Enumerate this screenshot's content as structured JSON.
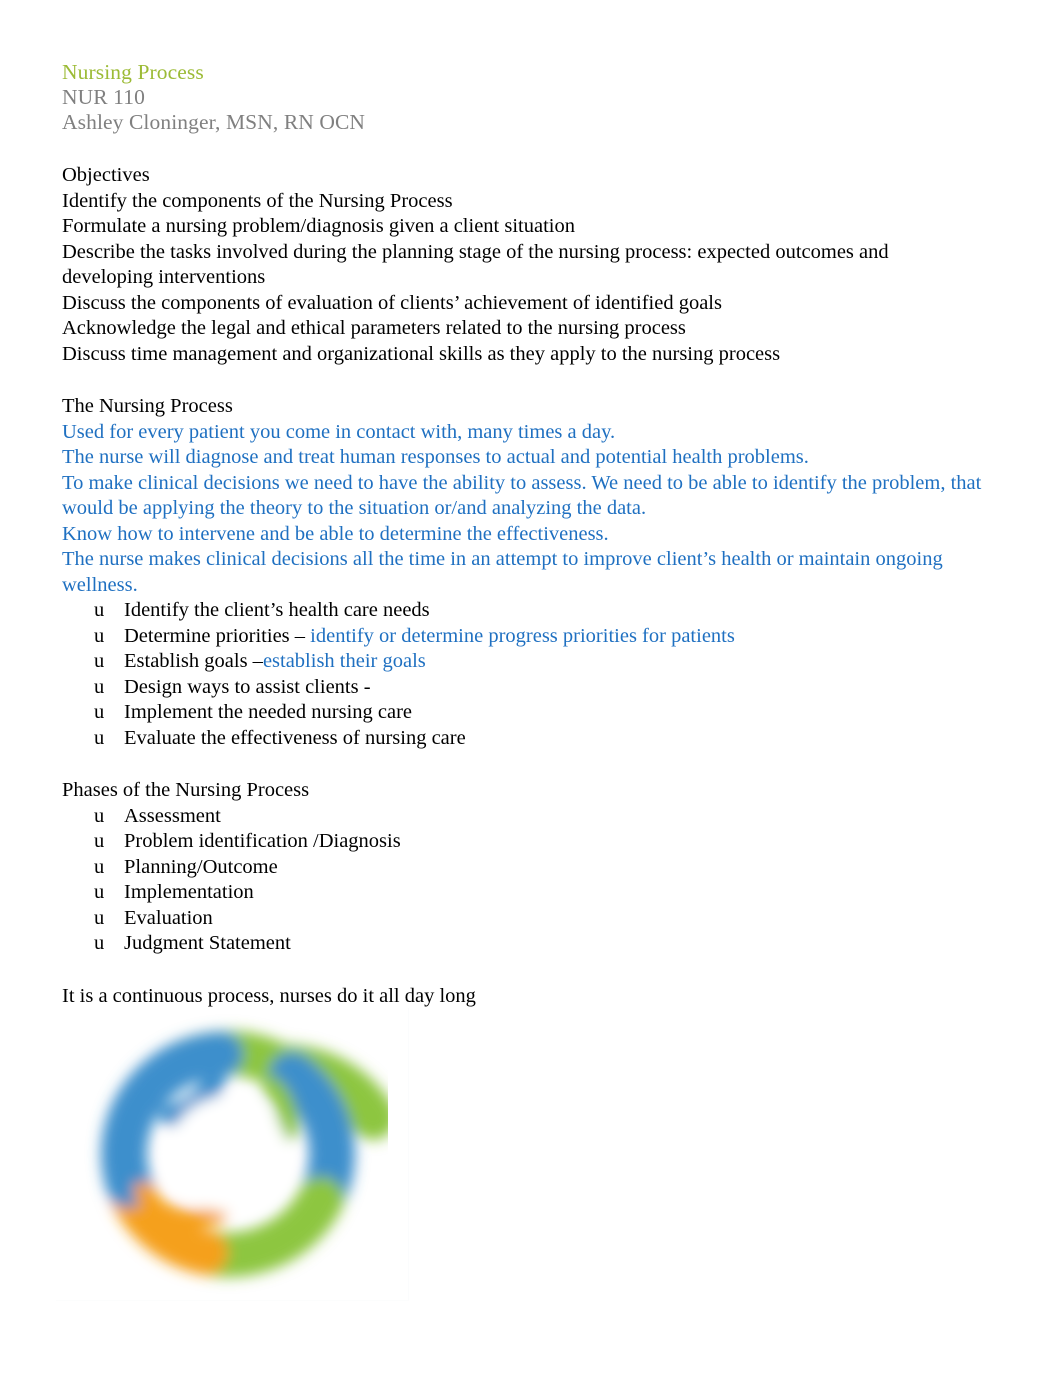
{
  "header": {
    "title": "Nursing Process",
    "course": "NUR 110",
    "author": "Ashley Cloninger, MSN, RN OCN",
    "title_color": "#9CBB36",
    "subtitle_color": "#808080"
  },
  "objectives": {
    "heading": "Objectives",
    "items": [
      "Identify the components of the Nursing Process",
      "Formulate a nursing problem/diagnosis given a client situation",
      "Describe the tasks involved during the planning stage of the nursing process: expected outcomes and developing interventions",
      "Discuss the components of evaluation of clients’ achievement of identified goals",
      "Acknowledge the legal and ethical parameters related to the nursing process",
      "Discuss time management and organizational skills as they apply to the nursing process"
    ]
  },
  "nursing_process": {
    "heading": "The Nursing Process",
    "blue_color": "#1F70C1",
    "paragraphs": [
      "Used for every patient you come in contact with, many times a day.",
      "The nurse will diagnose and treat human responses to actual and potential health problems.",
      "To make clinical decisions we need to have the ability to assess. We need to be able to identify the problem, that would be applying the theory to the situation or/and analyzing the data.",
      "Know how to intervene and be able to determine the effectiveness.",
      "The nurse makes clinical decisions all the time in an attempt to improve client’s health or maintain ongoing wellness."
    ],
    "bullet_glyph": "u",
    "bullets": [
      {
        "black": "Identify the client’s health care needs",
        "blue": ""
      },
      {
        "black": "Determine priorities – ",
        "blue": "identify or determine progress priorities for patients"
      },
      {
        "black": "Establish goals –",
        "blue": "establish their goals"
      },
      {
        "black": "Design ways to assist clients -",
        "blue": ""
      },
      {
        "black": "Implement the needed nursing care",
        "blue": ""
      },
      {
        "black": "Evaluate the effectiveness of nursing care",
        "blue": ""
      }
    ]
  },
  "phases": {
    "heading": "Phases of the Nursing Process",
    "bullet_glyph": "u",
    "items": [
      "Assessment",
      "Problem identification /Diagnosis",
      "Planning/Outcome",
      "Implementation",
      "Evaluation",
      "Judgment Statement"
    ]
  },
  "closing": {
    "text": "It is a continuous process, nurses do it all day long"
  },
  "figure": {
    "name": "nursing-process-cycle-ring",
    "description": "Blurred four-segment circular ring diagram",
    "colors": {
      "green": "#8DC63F",
      "blue": "#3E8FCC",
      "orange": "#F5A01C"
    },
    "segments": [
      {
        "label": "green-top",
        "color": "#8DC63F",
        "start_deg": 300,
        "end_deg": 52
      },
      {
        "label": "blue-right",
        "color": "#3E8FCC",
        "start_deg": 52,
        "end_deg": 150
      },
      {
        "label": "green-bottom-right",
        "color": "#8DC63F",
        "start_deg": 150,
        "end_deg": 196
      },
      {
        "label": "orange-bottom-left",
        "color": "#F5A01C",
        "start_deg": 196,
        "end_deg": 252
      },
      {
        "label": "blue-left",
        "color": "#3E8FCC",
        "start_deg": 252,
        "end_deg": 300
      }
    ]
  }
}
